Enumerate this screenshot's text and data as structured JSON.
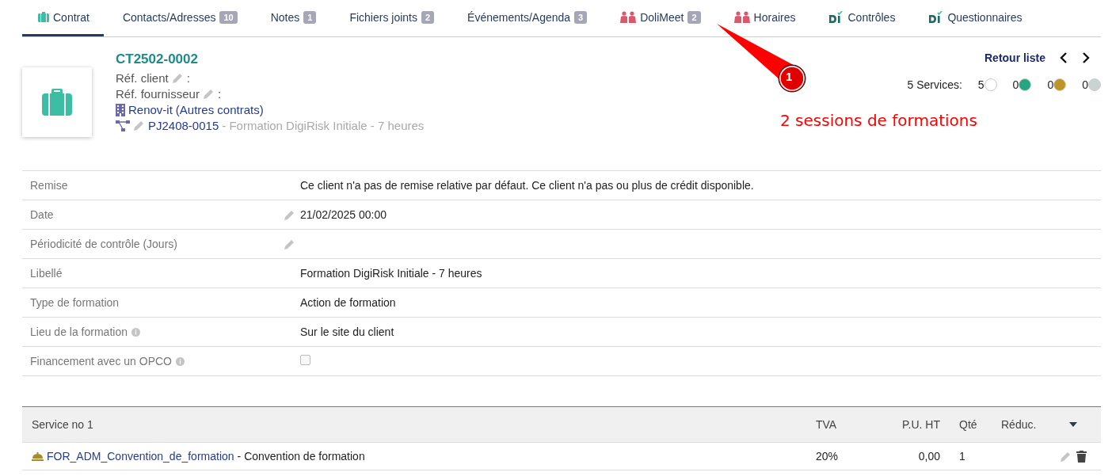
{
  "tabs": [
    {
      "kind": "briefcase",
      "label": "Contrat",
      "selected": true
    },
    {
      "kind": "plain",
      "label": "Contacts/Adresses",
      "badge": "10",
      "selected": false
    },
    {
      "kind": "plain",
      "label": "Notes",
      "badge": "1",
      "selected": false
    },
    {
      "kind": "plain",
      "label": "Fichiers joints",
      "badge": "2",
      "selected": false
    },
    {
      "kind": "plain",
      "label": "Événements/Agenda",
      "badge": "3",
      "selected": false
    },
    {
      "kind": "people",
      "label": "DoliMeet",
      "badge": "2",
      "selected": false
    },
    {
      "kind": "people",
      "label": "Horaires",
      "selected": false
    },
    {
      "kind": "di",
      "label": "Contrôles",
      "selected": false
    },
    {
      "kind": "di",
      "label": "Questionnaires",
      "selected": false
    }
  ],
  "header": {
    "ref": "CT2502-0002",
    "ref_client_label": "Réf. client",
    "ref_supplier_label": "Réf. fournisseur",
    "colon": ":",
    "company": "Renov-it",
    "company_other": "(Autres contrats)",
    "project_ref": "PJ2408-0015",
    "project_label": "- Formation DigiRisk Initiale - 7 heures"
  },
  "nav": {
    "back": "Retour liste"
  },
  "services": {
    "label": "5 Services:",
    "statuses": [
      {
        "count": "5",
        "color": "#ffffff"
      },
      {
        "count": "0",
        "color": "#25a580"
      },
      {
        "count": "0",
        "color": "#bc9526"
      },
      {
        "count": "0",
        "color": "#cad2d2"
      }
    ]
  },
  "annotation": {
    "number": "1",
    "text": "2 sessions de formations"
  },
  "fields": [
    {
      "kind": "text",
      "label": "Remise",
      "value": "Ce client n'a pas de remise relative par défaut. Ce client n'a pas ou plus de crédit disponible.",
      "editable": false,
      "info": false
    },
    {
      "kind": "text",
      "label": "Date",
      "value": "21/02/2025 00:00",
      "editable": true,
      "info": false
    },
    {
      "kind": "text",
      "label": "Périodicité de contrôle (Jours)",
      "editable": true,
      "info": false
    },
    {
      "kind": "text",
      "label": "Libellé",
      "value": "Formation DigiRisk Initiale - 7 heures",
      "editable": false,
      "info": false
    },
    {
      "kind": "text",
      "label": "Type de formation",
      "value": "Action de formation",
      "editable": false,
      "info": false
    },
    {
      "kind": "text",
      "label": "Lieu de la formation",
      "value": "Sur le site du client",
      "editable": false,
      "info": true
    },
    {
      "kind": "checkbox",
      "label": "Financement avec un OPCO",
      "checked": false,
      "editable": false,
      "info": true
    }
  ],
  "table": {
    "columns": [
      "Service no 1",
      "TVA",
      "P.U. HT",
      "Qté",
      "Réduc."
    ],
    "rows": [
      {
        "ref": "FOR_ADM_Convention_de_formation",
        "label": "- Convention de formation",
        "tva": "20%",
        "price": "0,00",
        "qty": "1"
      }
    ]
  }
}
